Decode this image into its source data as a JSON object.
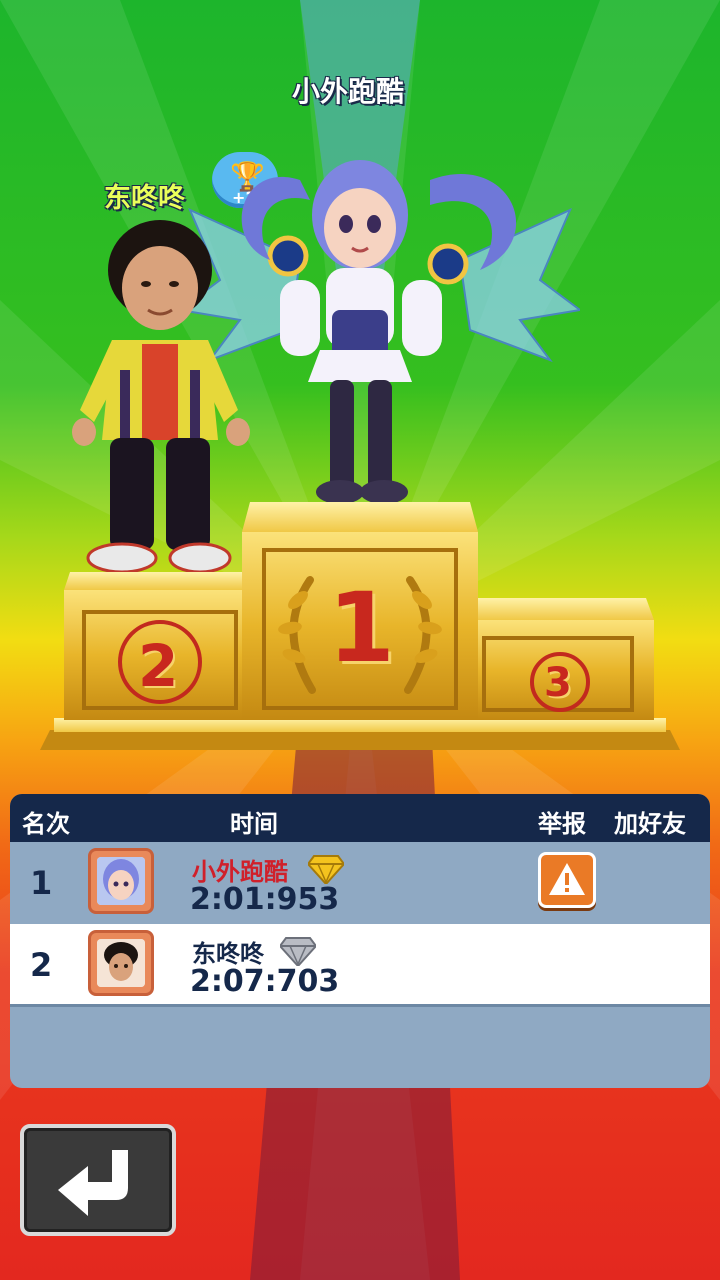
{
  "podium": {
    "first_place_name": "小外跑酷",
    "second_place_name": "东咚咚",
    "trophy_badge_text": "+2",
    "first_place_number": "1",
    "second_place_number": "2",
    "third_place_number": "3"
  },
  "leaderboard": {
    "headers": {
      "rank": "名次",
      "time": "时间",
      "report": "举报",
      "add_friend": "加好友"
    },
    "rows": [
      {
        "rank": "1",
        "name": "小外跑酷",
        "time": "2:01:953",
        "name_color": "#d0202a",
        "gem": "gold-diamond-icon"
      },
      {
        "rank": "2",
        "name": "东咚咚",
        "time": "2:07:703",
        "name_color": "#15284a",
        "gem": "silver-diamond-icon"
      }
    ]
  },
  "icons": {
    "report": "warning-icon",
    "back": "return-arrow-icon",
    "trophy": "trophy-icon"
  },
  "colors": {
    "header_bg": "#15284a",
    "row_bg": "#8fa9c3",
    "report_btn": "#ea7a26",
    "first_name": "#d0202a"
  }
}
